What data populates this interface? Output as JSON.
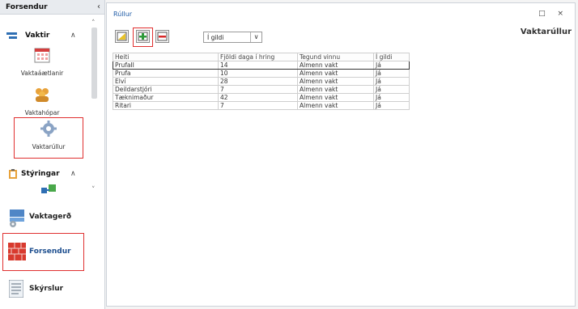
{
  "sidebar": {
    "title": "Forsendur",
    "collapse_icon": "‹",
    "groups": {
      "vaktir": {
        "label": "Vaktir",
        "items": [
          {
            "label": "Vaktaáætlanir",
            "icon": "calendar-icon"
          },
          {
            "label": "Vaktahópar",
            "icon": "people-group-icon"
          },
          {
            "label": "Vaktarúllur",
            "icon": "gear-icon"
          }
        ]
      },
      "styringar": {
        "label": "Stýringar"
      }
    },
    "bottom_items": [
      {
        "label": "Vaktagerð",
        "icon": "shift-type-icon"
      },
      {
        "label": "Forsendur",
        "icon": "brick-wall-icon"
      },
      {
        "label": "Skýrslur",
        "icon": "report-icon"
      }
    ]
  },
  "main": {
    "breadcrumb": "Rúllur",
    "window_controls": "□ ×",
    "page_title": "Vaktarúllur",
    "toolbar": {
      "edit_icon": "edit-icon",
      "add_icon": "add-icon",
      "remove_icon": "remove-icon"
    },
    "filter": {
      "value": "Í gildi",
      "arrow": "∨"
    },
    "grid": {
      "columns": [
        "Heiti",
        "Fjöldi daga í hring",
        "Tegund vinnu",
        "Í gildi"
      ],
      "rows": [
        [
          "PrufaII",
          "14",
          "Almenn vakt",
          "Já"
        ],
        [
          "Prufa",
          "10",
          "Almenn vakt",
          "Já"
        ],
        [
          "Elví",
          "28",
          "Almenn vakt",
          "Já"
        ],
        [
          "Deildarstjóri",
          "7",
          "Almenn vakt",
          "Já"
        ],
        [
          "Tæknimaður",
          "42",
          "Almenn vakt",
          "Já"
        ],
        [
          "Ritari",
          "7",
          "Almenn vakt",
          "Já"
        ]
      ]
    }
  },
  "colors": {
    "highlight": "#e03030",
    "link": "#1d5aa6"
  }
}
